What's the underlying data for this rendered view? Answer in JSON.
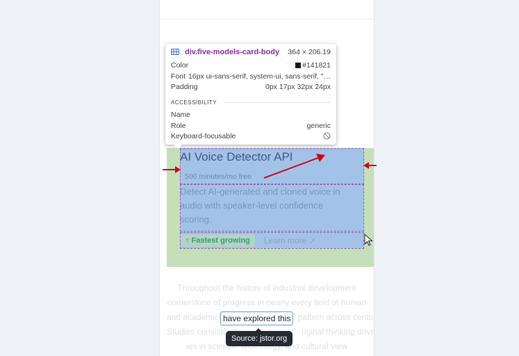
{
  "card": {
    "title": "AI Voice Detector API",
    "subtitle": "500 minutes/mo free",
    "description_lines": [
      "Detect AI-generated and cloned voice in",
      "audio with speaker-level confidence",
      "scoring."
    ],
    "badge": "↑ Fastest growing",
    "link": "Learn more ↗"
  },
  "tooltip": {
    "selector": "div.five-models-card-body",
    "dimensions": "364 × 206.19",
    "color_label": "Color",
    "color_value": "#141821",
    "color_swatch": "#141821",
    "font_label": "Font",
    "font_value": "16px ui-sans-serif, system-ui, sans-serif, \"…",
    "padding_label": "Padding",
    "padding_value": "0px 17px 32px 24px",
    "section": "ACCESSIBILITY",
    "name_label": "Name",
    "name_value": "",
    "role_label": "Role",
    "role_value": "generic",
    "keyboard_label": "Keyboard-focusable"
  },
  "body_text": {
    "lines": [
      "Throughout the history of industrial development",
      "cornerstone of progress in nearly every field of human",
      "and academics",
      "Studies consistently",
      "ies in science, technology, and cultural view"
    ],
    "line3_tail": "pattern across centuries",
    "line4_tail": "riginal thinking drives the",
    "highlight": "have explored this",
    "source": "Source: jstor.org"
  },
  "colors": {
    "padding": "#c5e0b9",
    "content": "#a2c3e7",
    "arrow": "#d0021b",
    "selector": "#8a2d9e"
  }
}
